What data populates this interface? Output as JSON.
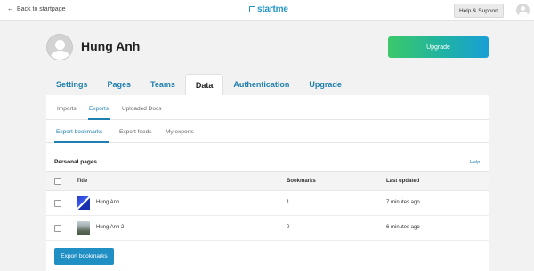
{
  "topbar": {
    "back_label": "Back to startpage",
    "logo_text": "startme",
    "help_label": "Help & Support"
  },
  "profile": {
    "name": "Hung Anh",
    "upgrade_label": "Upgrade"
  },
  "main_tabs": [
    {
      "label": "Settings",
      "active": false
    },
    {
      "label": "Pages",
      "active": false
    },
    {
      "label": "Teams",
      "active": false
    },
    {
      "label": "Data",
      "active": true
    },
    {
      "label": "Authentication",
      "active": false
    },
    {
      "label": "Upgrade",
      "active": false
    }
  ],
  "sub_tabs": [
    {
      "label": "Imports",
      "active": false
    },
    {
      "label": "Exports",
      "active": true
    },
    {
      "label": "Uploaded Docs",
      "active": false
    }
  ],
  "export_tabs": [
    {
      "label": "Export bookmarks",
      "active": true
    },
    {
      "label": "Export feeds",
      "active": false
    },
    {
      "label": "My exports",
      "active": false
    }
  ],
  "section": {
    "title": "Personal pages",
    "help_label": "Help"
  },
  "table": {
    "columns": [
      "Title",
      "Bookmarks",
      "Last updated"
    ],
    "rows": [
      {
        "title": "Hung Anh",
        "bookmarks": "1",
        "updated": "7 minutes ago"
      },
      {
        "title": "Hung Anh 2",
        "bookmarks": "0",
        "updated": "6 minutes ago"
      }
    ]
  },
  "export_button_label": "Export bookmarks",
  "colors": {
    "accent": "#1f7fae",
    "button": "#1f8fc4",
    "upgrade_gradient_start": "#3cc86a",
    "upgrade_gradient_end": "#1a9fd6"
  }
}
